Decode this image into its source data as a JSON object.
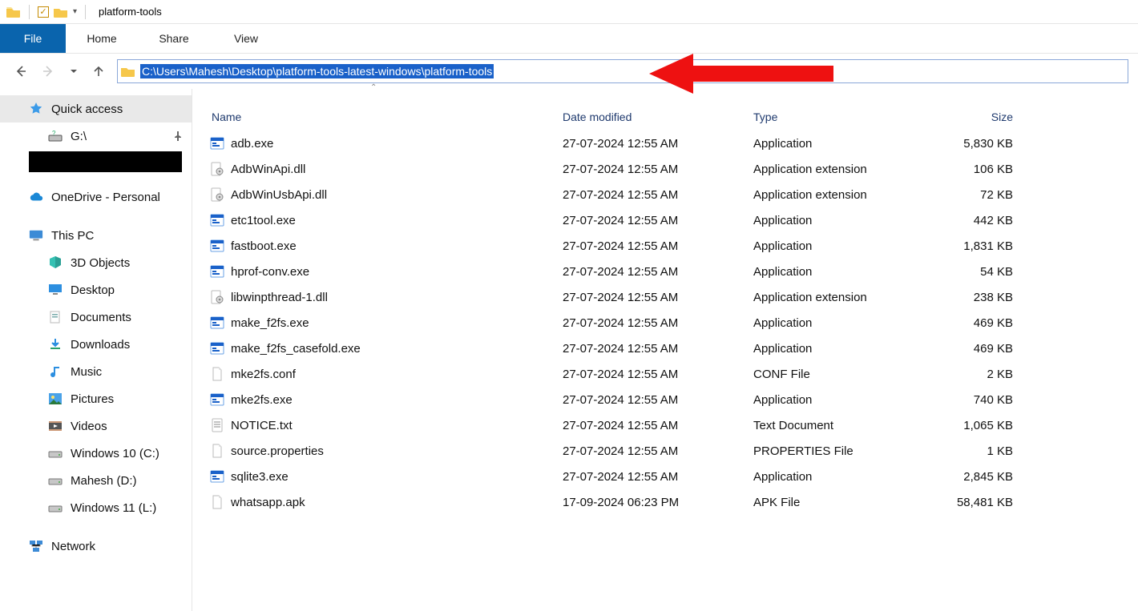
{
  "window": {
    "title": "platform-tools"
  },
  "ribbon": {
    "file": "File",
    "tabs": [
      "Home",
      "Share",
      "View"
    ]
  },
  "address_bar": {
    "path": "C:\\Users\\Mahesh\\Desktop\\platform-tools-latest-windows\\platform-tools"
  },
  "sidebar": {
    "quick_access": "Quick access",
    "quick_items": [
      {
        "label": "G:\\",
        "icon": "drive-question"
      }
    ],
    "onedrive": "OneDrive - Personal",
    "this_pc": "This PC",
    "pc_items": [
      {
        "label": "3D Objects",
        "icon": "cube"
      },
      {
        "label": "Desktop",
        "icon": "desktop"
      },
      {
        "label": "Documents",
        "icon": "documents"
      },
      {
        "label": "Downloads",
        "icon": "downloads"
      },
      {
        "label": "Music",
        "icon": "music"
      },
      {
        "label": "Pictures",
        "icon": "pictures"
      },
      {
        "label": "Videos",
        "icon": "videos"
      },
      {
        "label": "Windows 10 (C:)",
        "icon": "drive"
      },
      {
        "label": "Mahesh (D:)",
        "icon": "drive"
      },
      {
        "label": "Windows 11 (L:)",
        "icon": "drive"
      }
    ],
    "network": "Network"
  },
  "columns": {
    "name": "Name",
    "date": "Date modified",
    "type": "Type",
    "size": "Size"
  },
  "files": [
    {
      "name": "adb.exe",
      "date": "27-07-2024 12:55 AM",
      "type": "Application",
      "size": "5,830 KB",
      "icon": "exe"
    },
    {
      "name": "AdbWinApi.dll",
      "date": "27-07-2024 12:55 AM",
      "type": "Application extension",
      "size": "106 KB",
      "icon": "dll"
    },
    {
      "name": "AdbWinUsbApi.dll",
      "date": "27-07-2024 12:55 AM",
      "type": "Application extension",
      "size": "72 KB",
      "icon": "dll"
    },
    {
      "name": "etc1tool.exe",
      "date": "27-07-2024 12:55 AM",
      "type": "Application",
      "size": "442 KB",
      "icon": "exe"
    },
    {
      "name": "fastboot.exe",
      "date": "27-07-2024 12:55 AM",
      "type": "Application",
      "size": "1,831 KB",
      "icon": "exe"
    },
    {
      "name": "hprof-conv.exe",
      "date": "27-07-2024 12:55 AM",
      "type": "Application",
      "size": "54 KB",
      "icon": "exe"
    },
    {
      "name": "libwinpthread-1.dll",
      "date": "27-07-2024 12:55 AM",
      "type": "Application extension",
      "size": "238 KB",
      "icon": "dll"
    },
    {
      "name": "make_f2fs.exe",
      "date": "27-07-2024 12:55 AM",
      "type": "Application",
      "size": "469 KB",
      "icon": "exe"
    },
    {
      "name": "make_f2fs_casefold.exe",
      "date": "27-07-2024 12:55 AM",
      "type": "Application",
      "size": "469 KB",
      "icon": "exe"
    },
    {
      "name": "mke2fs.conf",
      "date": "27-07-2024 12:55 AM",
      "type": "CONF File",
      "size": "2 KB",
      "icon": "blank"
    },
    {
      "name": "mke2fs.exe",
      "date": "27-07-2024 12:55 AM",
      "type": "Application",
      "size": "740 KB",
      "icon": "exe"
    },
    {
      "name": "NOTICE.txt",
      "date": "27-07-2024 12:55 AM",
      "type": "Text Document",
      "size": "1,065 KB",
      "icon": "txt"
    },
    {
      "name": "source.properties",
      "date": "27-07-2024 12:55 AM",
      "type": "PROPERTIES File",
      "size": "1 KB",
      "icon": "blank"
    },
    {
      "name": "sqlite3.exe",
      "date": "27-07-2024 12:55 AM",
      "type": "Application",
      "size": "2,845 KB",
      "icon": "exe"
    },
    {
      "name": "whatsapp.apk",
      "date": "17-09-2024 06:23 PM",
      "type": "APK File",
      "size": "58,481 KB",
      "icon": "blank"
    }
  ]
}
